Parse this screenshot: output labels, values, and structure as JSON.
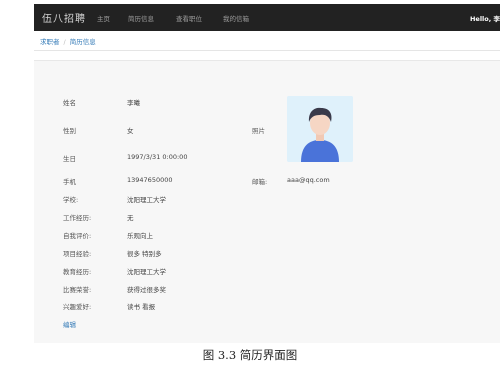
{
  "navbar": {
    "brand": "伍八招聘",
    "items": [
      "主页",
      "简历信息",
      "查看职位",
      "我的信箱"
    ],
    "greeting": "Hello, 李"
  },
  "breadcrumb": {
    "parent": "求职者",
    "separator": "/",
    "current": "简历信息"
  },
  "resume": {
    "name": {
      "label": "姓名",
      "value": "李曦"
    },
    "gender": {
      "label": "性别",
      "value": "女"
    },
    "photo_label": "照片",
    "birthday": {
      "label": "生日",
      "value": "1997/3/31 0:00:00"
    },
    "phone": {
      "label": "手机",
      "value": "13947650000"
    },
    "email": {
      "label": "邮箱:",
      "value": "aaa@qq.com"
    },
    "school": {
      "label": "学校:",
      "value": "沈阳理工大学"
    },
    "experience": {
      "label": "工作经历:",
      "value": "无"
    },
    "self_eval": {
      "label": "自我评价:",
      "value": "乐观向上"
    },
    "projects": {
      "label": "项目经验:",
      "value": "很多 特别多"
    },
    "education": {
      "label": "教育经历:",
      "value": "沈阳理工大学"
    },
    "awards": {
      "label": "比赛荣誉:",
      "value": "获得过很多奖"
    },
    "hobbies": {
      "label": "兴趣爱好:",
      "value": "读书 看报"
    }
  },
  "edit_label": "编辑",
  "caption": "图 3.3  简历界面图",
  "colors": {
    "navbar": "#222222",
    "link": "#337ab7",
    "photo_bg": "#dff1fb",
    "avatar_shirt": "#4a73d9"
  }
}
